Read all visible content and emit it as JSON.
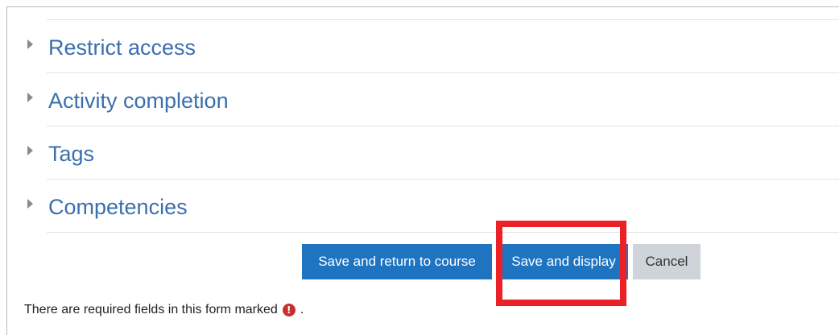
{
  "sections": [
    {
      "title": "Restrict access"
    },
    {
      "title": "Activity completion"
    },
    {
      "title": "Tags"
    },
    {
      "title": "Competencies"
    }
  ],
  "buttons": {
    "save_return": "Save and return to course",
    "save_display": "Save and display",
    "cancel": "Cancel"
  },
  "footer": {
    "required_note": "There are required fields in this form marked",
    "required_icon": "!",
    "trailing_period": "."
  },
  "colors": {
    "link_blue": "#3b6fae",
    "primary_button": "#1f74c2",
    "secondary_button": "#ced4da",
    "highlight_red": "#ec2127",
    "required_icon": "#c9302c"
  },
  "icons": {
    "section_toggle": "chevron-right-icon",
    "required_marker": "exclamation-circle-icon"
  }
}
